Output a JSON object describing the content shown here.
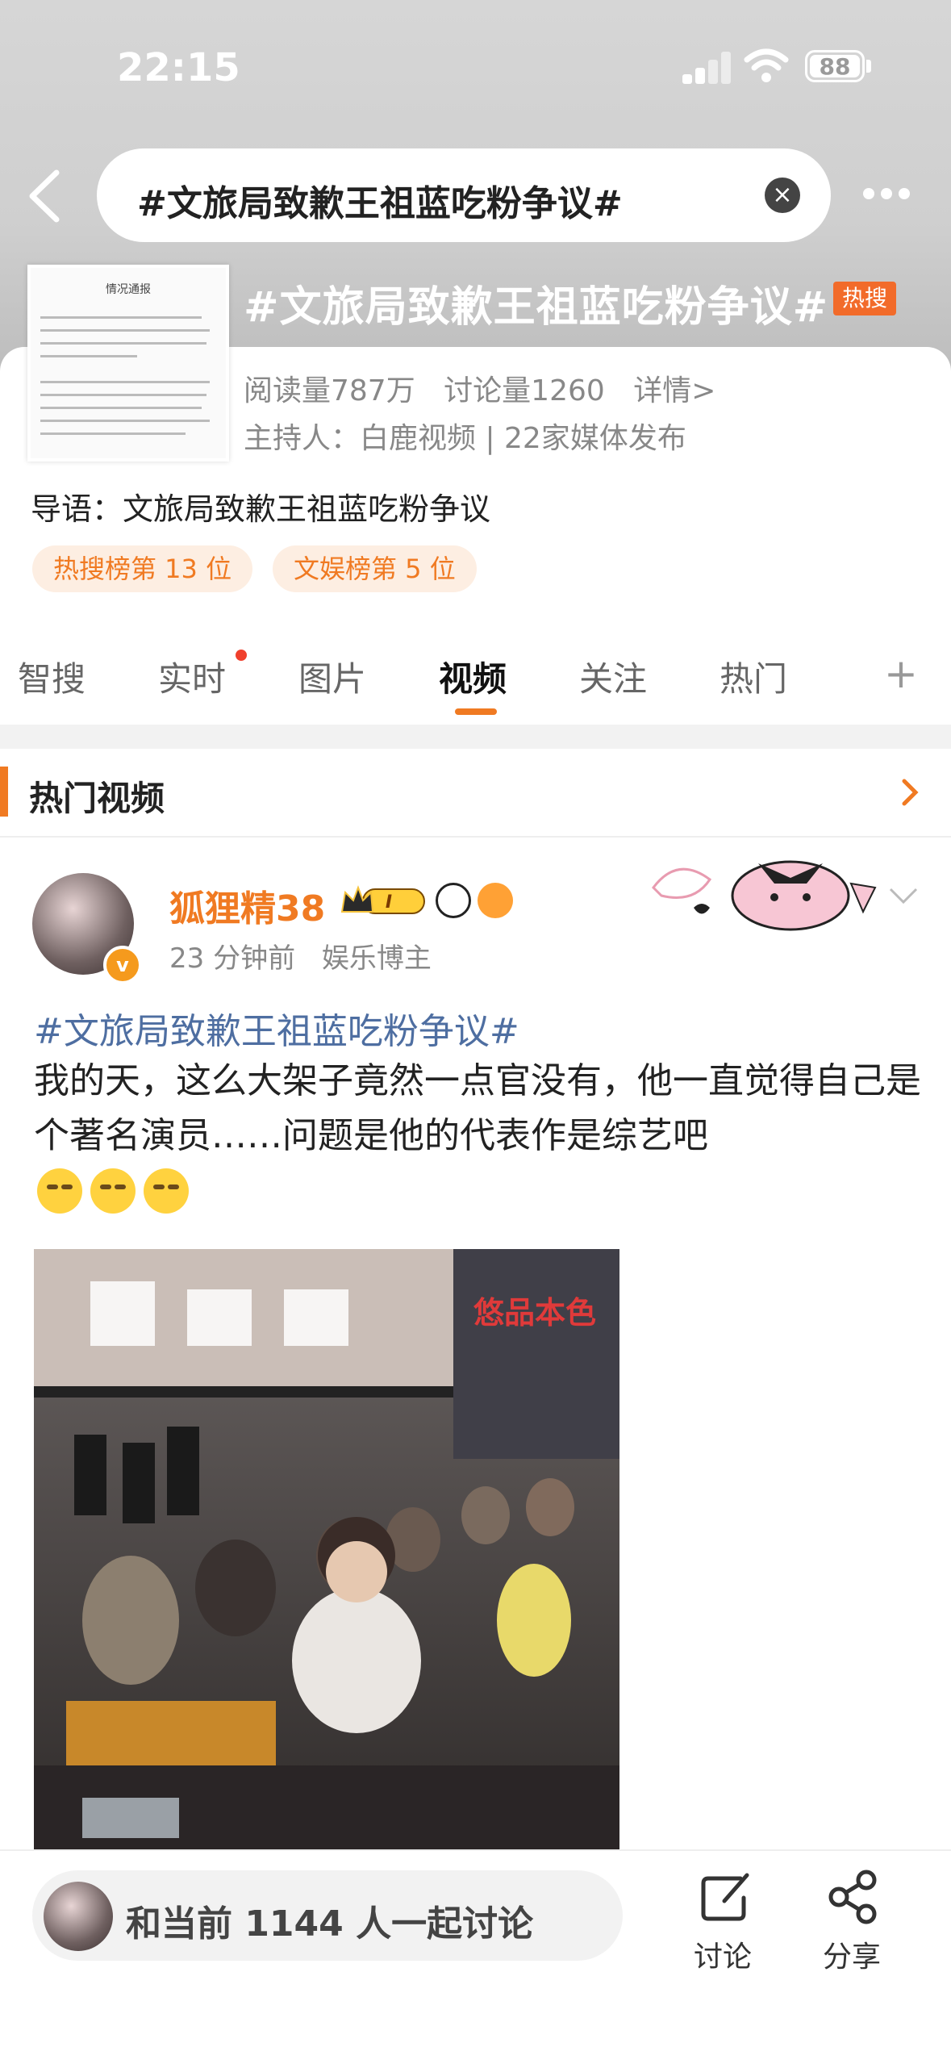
{
  "status_bar": {
    "time": "22:15",
    "battery": "88"
  },
  "nav": {
    "search_query": "#文旅局致歉王祖蓝吃粉争议#"
  },
  "topic": {
    "title": "#文旅局致歉王祖蓝吃粉争议#",
    "badge": "热搜",
    "thumb_title": "情况通报",
    "reads": "阅读量787万",
    "discussions": "讨论量1260",
    "details": "详情>",
    "host": "主持人：白鹿视频 | 22家媒体发布",
    "intro": "导语：文旅局致歉王祖蓝吃粉争议",
    "ranks": [
      "热搜榜第 13 位",
      "文娱榜第 5 位"
    ]
  },
  "tabs": [
    {
      "label": "智搜"
    },
    {
      "label": "实时"
    },
    {
      "label": "图片"
    },
    {
      "label": "视频",
      "active": true
    },
    {
      "label": "关注"
    },
    {
      "label": "热门"
    }
  ],
  "section": {
    "title": "热门视频"
  },
  "post": {
    "username": "狐狸精38",
    "vip_level": "I",
    "time": "23 分钟前",
    "role": "娱乐博主",
    "hashtag": "#文旅局致歉王祖蓝吃粉争议#",
    "text": "我的天，这么大架子竟然一点官没有，他一直觉得自己是个著名演员……问题是他的代表作是综艺吧",
    "video_sign": "悠品本色"
  },
  "bottom_bar": {
    "discuss_prompt": "和当前 1144 人一起讨论",
    "comment_label": "讨论",
    "share_label": "分享"
  },
  "colors": {
    "accent": "#f07a22",
    "link": "#4e6ea1",
    "hot_badge": "#f26b2a"
  }
}
